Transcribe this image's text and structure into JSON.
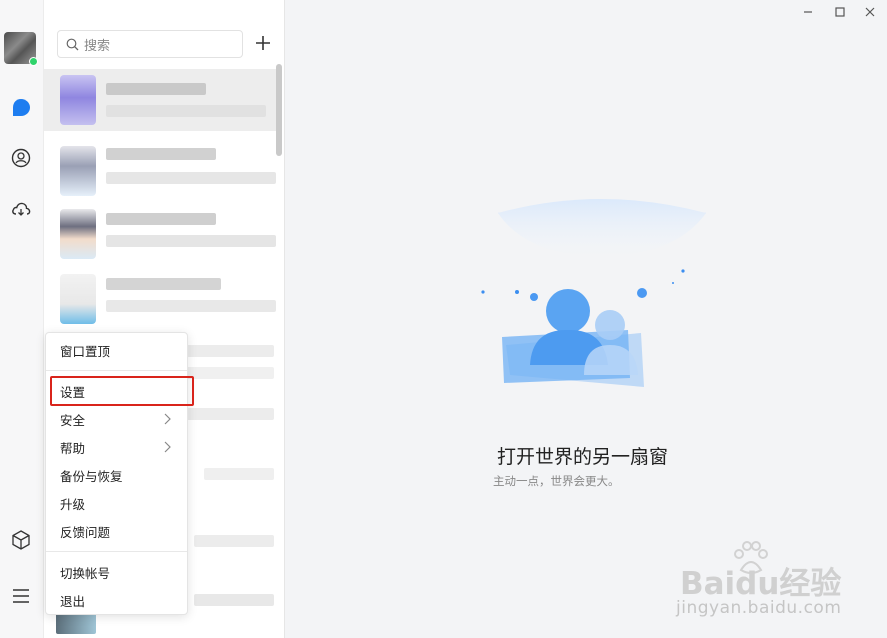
{
  "search": {
    "placeholder": "搜索"
  },
  "menu": {
    "items": [
      {
        "label": "窗口置顶"
      },
      {
        "label": "设置"
      },
      {
        "label": "安全"
      },
      {
        "label": "帮助"
      },
      {
        "label": "备份与恢复"
      },
      {
        "label": "升级"
      },
      {
        "label": "反馈问题"
      },
      {
        "label": "切换帐号"
      },
      {
        "label": "退出"
      }
    ],
    "highlighted": "设置"
  },
  "main": {
    "empty_title": "打开世界的另一扇窗",
    "empty_subtitle": "主动一点，世界会更大。"
  },
  "watermark": {
    "logo": "Baidu经验",
    "url": "jingyan.baidu.com"
  },
  "colors": {
    "accent_blue": "#1e7df0",
    "online_green": "#2fd36b",
    "highlight_red": "#d9241b"
  },
  "icons": {
    "rail": [
      "chat-bubble-icon",
      "contacts-icon",
      "cloud-icon",
      "cube-icon",
      "hamburger-menu-icon"
    ],
    "window": [
      "minimize-icon",
      "maximize-icon",
      "close-icon"
    ]
  }
}
